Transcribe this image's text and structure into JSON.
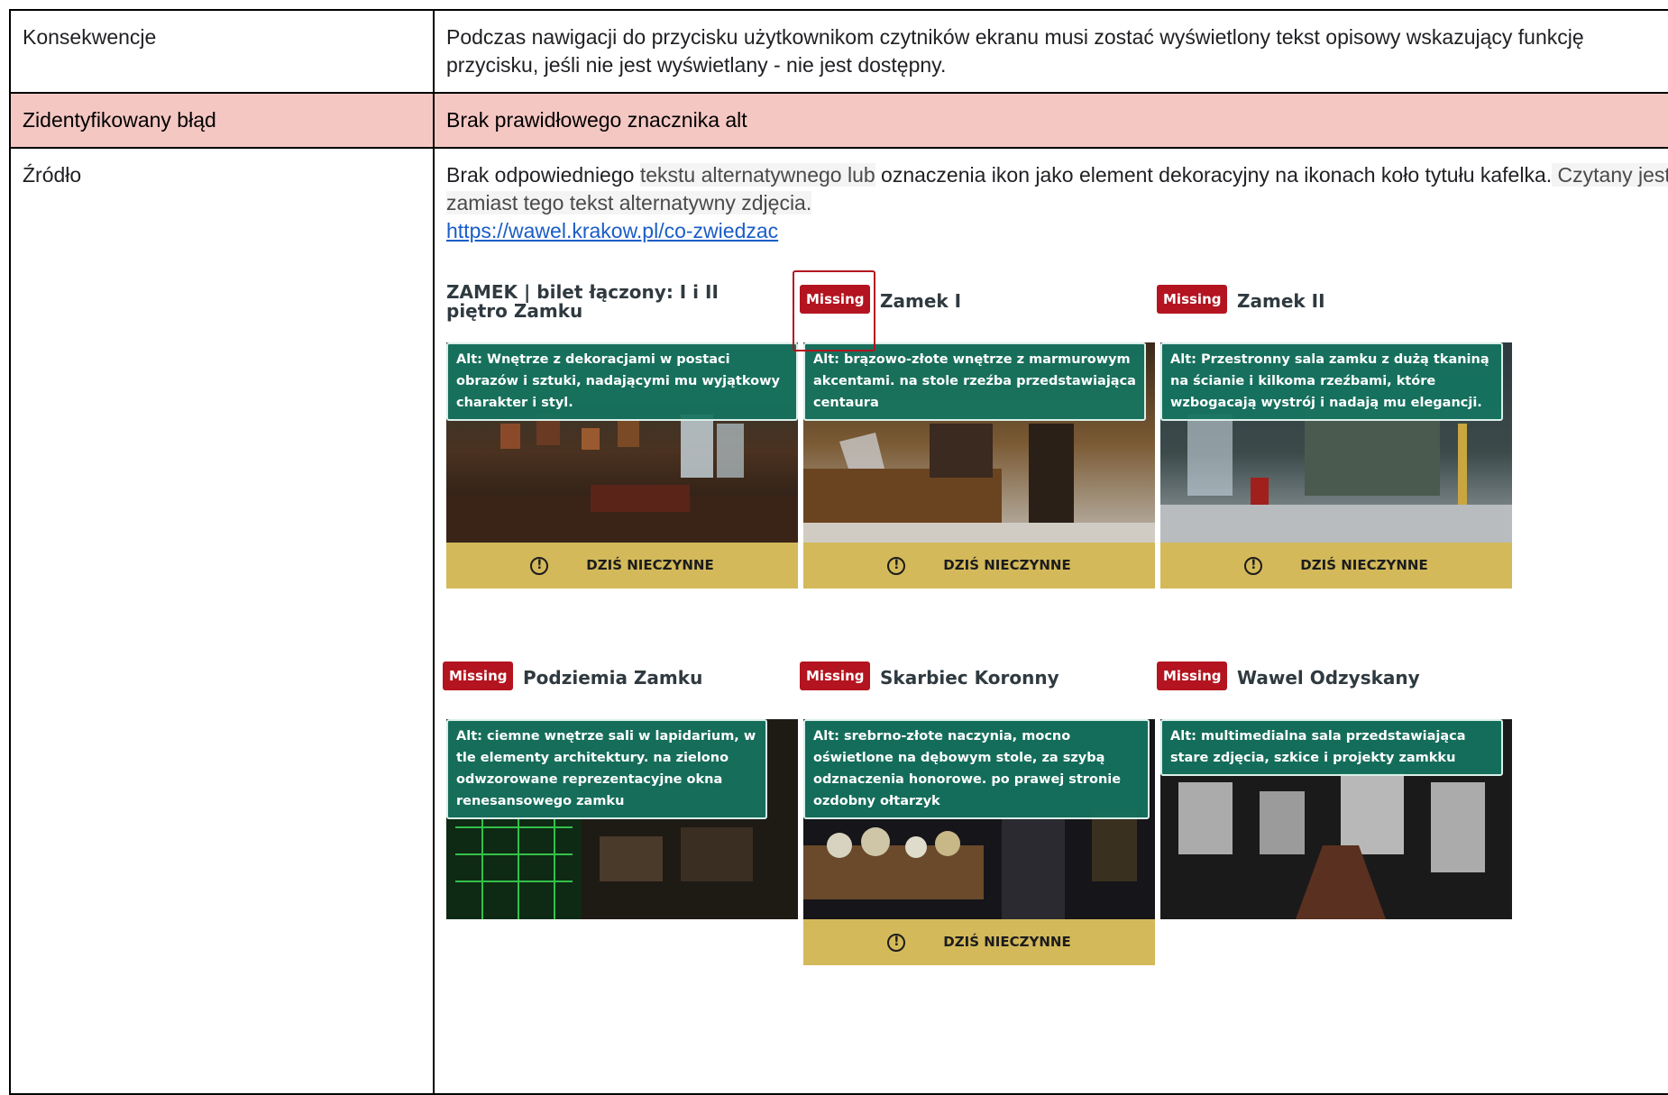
{
  "table": {
    "consequences": {
      "label": "Konsekwencje",
      "text": "Podczas nawigacji do przycisku użytkownikom czytników ekranu musi zostać wyświetlony tekst opisowy wskazujący funkcję przycisku, jeśli nie jest wyświetlany - nie jest dostępny."
    },
    "error": {
      "label": "Zidentyfikowany błąd",
      "text": "Brak prawidłowego znacznika alt"
    },
    "source": {
      "label": "Źródło",
      "text_part1": "Brak odpowiedniego ",
      "text_highlight1": "tekstu alternatywnego lub",
      "text_part2": " oznaczenia ikon jako element dekoracyjny na ikonach koło tytułu kafelka.",
      "text_highlight2": " Czytany jest zamiast tego tekst alternatywny zdjęcia.",
      "link": "https://wawel.krakow.pl/co-zwiedzac"
    }
  },
  "screenshot": {
    "missing_label": "Missing",
    "closed_label": "DZIŚ NIECZYNNE",
    "tiles": [
      {
        "title": "ZAMEK | bilet łączony: I i II piętro Zamku",
        "alt": "Alt: Wnętrze z dekoracjami w postaci obrazów i sztuki, nadającymi mu wyjątkowy charakter i styl."
      },
      {
        "title": "Zamek I",
        "alt": "Alt: brązowo-złote wnętrze z marmurowym akcentami. na stole rzeźba przedstawiająca centaura"
      },
      {
        "title": "Zamek II",
        "alt": "Alt: Przestronny sala zamku z dużą tkaniną na ścianie i kilkoma rzeźbami, które wzbogacają wystrój i nadają mu elegancji."
      },
      {
        "title": "Podziemia Zamku",
        "alt": "Alt: ciemne wnętrze sali w lapidarium, w tle elementy architektury. na zielono odwzorowane reprezentacyjne okna renesansowego zamku"
      },
      {
        "title": "Skarbiec Koronny",
        "alt": "Alt: srebrno-złote naczynia, mocno oświetlone na dębowym stole, za szybą odznaczenia honorowe. po prawej stronie ozdobny ołtarzyk"
      },
      {
        "title": "Wawel Odzyskany",
        "alt": "Alt: multimedialna sala przedstawiająca stare zdjęcia, szkice i projekty zamkku"
      }
    ]
  }
}
